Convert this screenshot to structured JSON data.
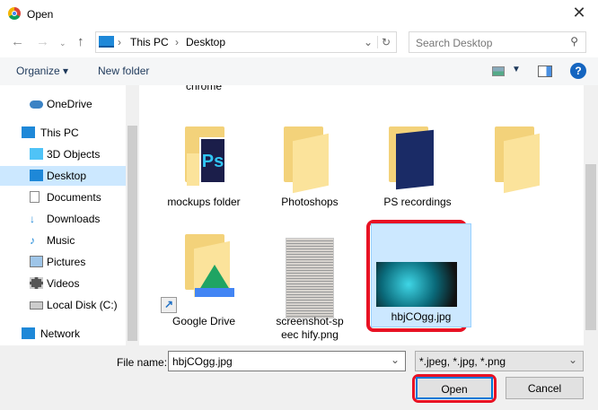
{
  "window": {
    "title": "Open"
  },
  "nav": {
    "path": [
      "This PC",
      "Desktop"
    ],
    "search_placeholder": "Search Desktop"
  },
  "toolbar": {
    "organize": "Organize",
    "new_folder": "New folder"
  },
  "sidebar": {
    "items": [
      {
        "label": "OneDrive",
        "icon": "cloud-icon"
      },
      {
        "label": "This PC",
        "icon": "computer-icon"
      },
      {
        "label": "3D Objects",
        "icon": "cube-icon"
      },
      {
        "label": "Desktop",
        "icon": "desktop-icon",
        "selected": true
      },
      {
        "label": "Documents",
        "icon": "document-icon"
      },
      {
        "label": "Downloads",
        "icon": "download-icon"
      },
      {
        "label": "Music",
        "icon": "music-icon"
      },
      {
        "label": "Pictures",
        "icon": "pictures-icon"
      },
      {
        "label": "Videos",
        "icon": "videos-icon"
      },
      {
        "label": "Local Disk (C:)",
        "icon": "disk-icon"
      },
      {
        "label": "Network",
        "icon": "network-icon"
      }
    ]
  },
  "files": {
    "partial_label": "chrome",
    "items": [
      {
        "label": "mockups folder"
      },
      {
        "label": "Photoshops"
      },
      {
        "label": "PS recordings"
      },
      {
        "label": ""
      },
      {
        "label": "Google Drive"
      },
      {
        "label": "screenshot-speec hify.png"
      },
      {
        "label": "hbjCOgg.jpg",
        "selected": true
      }
    ]
  },
  "bottom": {
    "file_name_label": "File name:",
    "file_name_value": "hbjCOgg.jpg",
    "filter": "*.jpeg, *.jpg, *.png",
    "open": "Open",
    "cancel": "Cancel"
  },
  "colors": {
    "selection": "#cce8ff",
    "highlight_ring": "#e81123",
    "folder": "#f3d27a"
  }
}
